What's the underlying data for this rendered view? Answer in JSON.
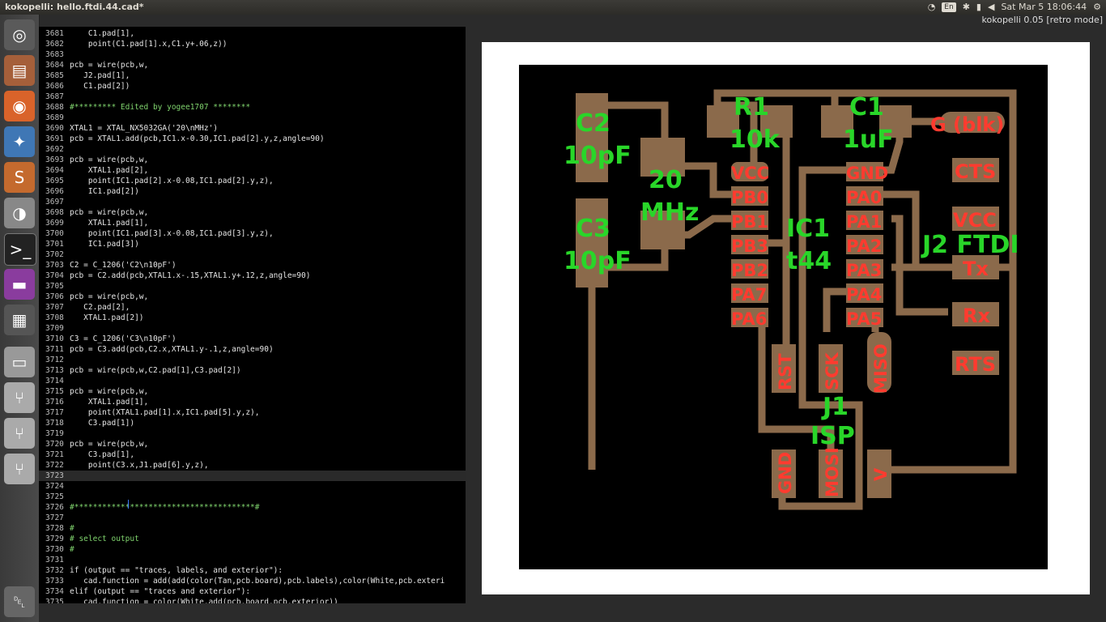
{
  "window": {
    "title": "kokopelli:  hello.ftdi.44.cad*",
    "version": "kokopelli 0.05 [retro mode]"
  },
  "tray": {
    "keyboard": "En",
    "datetime": "Sat Mar  5 18:06:44"
  },
  "launcher": [
    "ubuntu-logo-icon",
    "files-icon",
    "firefox-icon",
    "python-icon",
    "sublime-icon",
    "system-monitor-icon",
    "terminal-icon",
    "app-icon",
    "workspace-icon",
    "drive-icon",
    "usb-drive-icon",
    "usb-drive-icon",
    "usb-drive-icon",
    "trash-icon"
  ],
  "code": [
    {
      "n": "3681",
      "t": "    C1.pad[1],"
    },
    {
      "n": "3682",
      "t": "    point(C1.pad[1].x,C1.y+.06,z))"
    },
    {
      "n": "3683",
      "t": ""
    },
    {
      "n": "3684",
      "t": "pcb = wire(pcb,w,"
    },
    {
      "n": "3685",
      "t": "   J2.pad[1],"
    },
    {
      "n": "3686",
      "t": "   C1.pad[2])"
    },
    {
      "n": "3687",
      "t": ""
    },
    {
      "n": "3688",
      "t": "#********* Edited by yogee1707 ********"
    },
    {
      "n": "3689",
      "t": ""
    },
    {
      "n": "3690",
      "t": "XTAL1 = XTAL_NX5032GA('20\\nMHz')"
    },
    {
      "n": "3691",
      "t": "pcb = XTAL1.add(pcb,IC1.x-0.30,IC1.pad[2].y,z,angle=90)"
    },
    {
      "n": "3692",
      "t": ""
    },
    {
      "n": "3693",
      "t": "pcb = wire(pcb,w,"
    },
    {
      "n": "3694",
      "t": "    XTAL1.pad[2],"
    },
    {
      "n": "3695",
      "t": "    point(IC1.pad[2].x-0.08,IC1.pad[2].y,z),"
    },
    {
      "n": "3696",
      "t": "    IC1.pad[2])"
    },
    {
      "n": "3697",
      "t": ""
    },
    {
      "n": "3698",
      "t": "pcb = wire(pcb,w,"
    },
    {
      "n": "3699",
      "t": "    XTAL1.pad[1],"
    },
    {
      "n": "3700",
      "t": "    point(IC1.pad[3].x-0.08,IC1.pad[3].y,z),"
    },
    {
      "n": "3701",
      "t": "    IC1.pad[3])"
    },
    {
      "n": "3702",
      "t": ""
    },
    {
      "n": "3703",
      "t": "C2 = C_1206('C2\\n10pF')"
    },
    {
      "n": "3704",
      "t": "pcb = C2.add(pcb,XTAL1.x-.15,XTAL1.y+.12,z,angle=90)"
    },
    {
      "n": "3705",
      "t": ""
    },
    {
      "n": "3706",
      "t": "pcb = wire(pcb,w,"
    },
    {
      "n": "3707",
      "t": "   C2.pad[2],"
    },
    {
      "n": "3708",
      "t": "   XTAL1.pad[2])"
    },
    {
      "n": "3709",
      "t": ""
    },
    {
      "n": "3710",
      "t": "C3 = C_1206('C3\\n10pF')"
    },
    {
      "n": "3711",
      "t": "pcb = C3.add(pcb,C2.x,XTAL1.y-.1,z,angle=90)"
    },
    {
      "n": "3712",
      "t": ""
    },
    {
      "n": "3713",
      "t": "pcb = wire(pcb,w,C2.pad[1],C3.pad[2])"
    },
    {
      "n": "3714",
      "t": ""
    },
    {
      "n": "3715",
      "t": "pcb = wire(pcb,w,"
    },
    {
      "n": "3716",
      "t": "    XTAL1.pad[1],"
    },
    {
      "n": "3717",
      "t": "    point(XTAL1.pad[1].x,IC1.pad[5].y,z),"
    },
    {
      "n": "3718",
      "t": "    C3.pad[1])"
    },
    {
      "n": "3719",
      "t": ""
    },
    {
      "n": "3720",
      "t": "pcb = wire(pcb,w,"
    },
    {
      "n": "3721",
      "t": "    C3.pad[1],"
    },
    {
      "n": "3722",
      "t": "    point(C3.x,J1.pad[6].y,z),"
    },
    {
      "n": "3723",
      "t": ""
    },
    {
      "n": "3724",
      "t": ""
    },
    {
      "n": "3725",
      "t": ""
    },
    {
      "n": "3726",
      "t": "#***************************************#"
    },
    {
      "n": "3727",
      "t": ""
    },
    {
      "n": "3728",
      "t": "#"
    },
    {
      "n": "3729",
      "t": "# select output"
    },
    {
      "n": "3730",
      "t": "#"
    },
    {
      "n": "3731",
      "t": ""
    },
    {
      "n": "3732",
      "t": "if (output == \"traces, labels, and exterior\"):"
    },
    {
      "n": "3733",
      "t": "   cad.function = add(add(color(Tan,pcb.board),pcb.labels),color(White,pcb.exteri"
    },
    {
      "n": "3734",
      "t": "elif (output == \"traces and exterior\"):"
    },
    {
      "n": "3735",
      "t": "   cad.function = color(White.add(pcb.board.pcb.exterior))"
    }
  ],
  "pcb_labels": {
    "c2": "C2",
    "c2v": "10pF",
    "c3": "C3",
    "c3v": "10pF",
    "xtal": "20",
    "xtalu": "MHz",
    "r1": "R1",
    "r1v": "10k",
    "c1": "C1",
    "c1v": "1uF",
    "g": "G (blk)",
    "cts": "CTS",
    "vcc2": "VCC",
    "j2": "J2 FTDI",
    "tx": "Tx",
    "rx": "Rx",
    "rts": "RTS",
    "ic1": "IC1",
    "ic1v": "t44",
    "vcc": "VCC",
    "pb0": "PB0",
    "pb1": "PB1",
    "pb3": "PB3",
    "pb2": "PB2",
    "pa7": "PA7",
    "pa6": "PA6",
    "gnd": "GND",
    "pa0": "PA0",
    "pa1": "PA1",
    "pa2": "PA2",
    "pa3": "PA3",
    "pa4": "PA4",
    "pa5": "PA5",
    "rst": "RST",
    "sck": "SCK",
    "miso": "MISO",
    "j1": "J1",
    "isp": "ISP",
    "gnd2": "GND",
    "mosi": "MOSI",
    "v": "V"
  },
  "colors": {
    "trace": "#8b6a4b",
    "green_label": "#29d629",
    "red_label": "#ff3b2f"
  }
}
